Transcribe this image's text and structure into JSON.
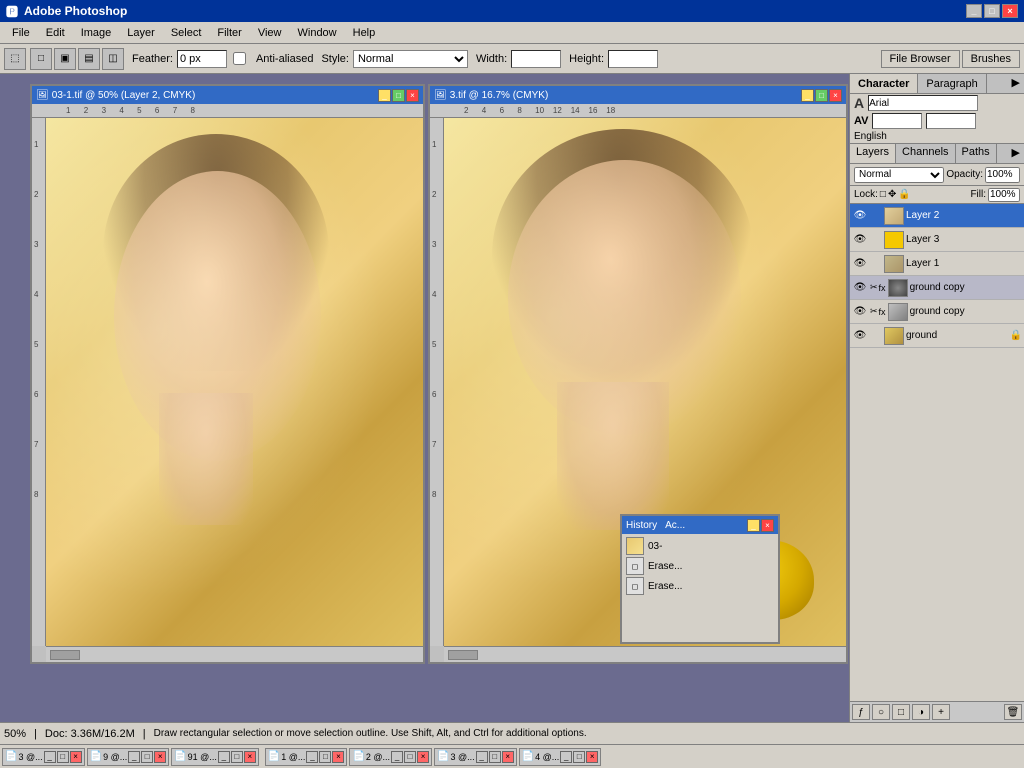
{
  "app": {
    "title": "Adobe Photoshop",
    "titlebar_controls": [
      "_",
      "□",
      "×"
    ]
  },
  "menubar": {
    "items": [
      "File",
      "Edit",
      "Image",
      "Layer",
      "Select",
      "Filter",
      "View",
      "Window",
      "Help"
    ]
  },
  "optionsbar": {
    "feather_label": "Feather:",
    "feather_value": "0 px",
    "anti_aliased_label": "Anti-aliased",
    "style_label": "Style:",
    "style_value": "Normal",
    "width_label": "Width:",
    "height_label": "Height:"
  },
  "top_right_buttons": [
    "File Browser",
    "Brushes"
  ],
  "doc1": {
    "title": "03-1.tif @ 50% (Layer 2, CMYK)",
    "zoom": "50%"
  },
  "doc2": {
    "title": "3.tif @ 16.7% (CMYK)"
  },
  "character_panel": {
    "tabs": [
      "Character",
      "Paragraph"
    ],
    "font": "Arial",
    "english_label": "English"
  },
  "layers_panel": {
    "tabs": [
      "Layers",
      "Channels",
      "Paths"
    ],
    "mode": "Normal",
    "opacity_label": "Opacity:",
    "lock_label": "Lock:",
    "fill_label": "Fill:",
    "layers": [
      {
        "name": "Layer 2",
        "active": true,
        "type": "normal",
        "eye": true
      },
      {
        "name": "Layer 3",
        "active": false,
        "type": "yellow",
        "eye": true
      },
      {
        "name": "Layer 1",
        "active": false,
        "type": "normal",
        "eye": true
      },
      {
        "name": "ground copy",
        "active": false,
        "type": "effect",
        "eye": true
      },
      {
        "name": "ground copy",
        "active": false,
        "type": "effect2",
        "eye": true
      },
      {
        "name": "ground",
        "active": false,
        "type": "base",
        "eye": true
      }
    ]
  },
  "history_panel": {
    "title": "History",
    "tabs": [
      "History",
      "Ac..."
    ],
    "items": [
      {
        "label": "03-",
        "icon": "photo"
      },
      {
        "label": "Erase...",
        "icon": "eraser"
      },
      {
        "label": "Erase...",
        "icon": "eraser"
      }
    ]
  },
  "statusbar": {
    "zoom": "50%",
    "doc_info": "Doc: 3.36M/16.2M",
    "hint": "Draw rectangular selection or move selection outline. Use Shift, Alt, and Ctrl for additional options."
  },
  "taskbar": {
    "items": [
      {
        "icon": "📄",
        "label": "3 @...",
        "id": "t1"
      },
      {
        "icon": "📄",
        "label": "9 @...",
        "id": "t2"
      },
      {
        "icon": "📄",
        "label": "91 @...",
        "id": "t3"
      },
      {
        "icon": "📄",
        "label": "1 @...",
        "id": "t4"
      },
      {
        "icon": "📄",
        "label": "2 @...",
        "id": "t5"
      },
      {
        "icon": "📄",
        "label": "3 @...",
        "id": "t6"
      },
      {
        "icon": "📄",
        "label": "4 @...",
        "id": "t7"
      }
    ]
  },
  "toolbox": {
    "tools": [
      {
        "icon": "⬚",
        "name": "marquee-tool"
      },
      {
        "icon": "✂",
        "name": "lasso-tool"
      },
      {
        "icon": "✥",
        "name": "move-tool"
      },
      {
        "icon": "◈",
        "name": "magic-wand-tool"
      },
      {
        "icon": "✂",
        "name": "crop-tool"
      },
      {
        "icon": "◉",
        "name": "healing-tool"
      },
      {
        "icon": "🖌",
        "name": "brush-tool"
      },
      {
        "icon": "S",
        "name": "clone-tool"
      },
      {
        "icon": "◼",
        "name": "eraser-tool"
      },
      {
        "icon": "░",
        "name": "gradient-tool"
      },
      {
        "icon": "◯",
        "name": "blur-tool"
      },
      {
        "icon": "△",
        "name": "dodge-tool"
      },
      {
        "icon": "✏",
        "name": "pen-tool"
      },
      {
        "icon": "T",
        "name": "text-tool"
      },
      {
        "icon": "⬡",
        "name": "shape-tool"
      },
      {
        "icon": "☞",
        "name": "notes-tool"
      },
      {
        "icon": "👁",
        "name": "eyedropper-tool"
      },
      {
        "icon": "✋",
        "name": "hand-tool"
      },
      {
        "icon": "⊕",
        "name": "zoom-tool"
      }
    ]
  },
  "colors": {
    "foreground": "#1a1a1a",
    "background": "#ffffff",
    "yellow_layer": "#f5c800",
    "accent_blue": "#316ac5"
  }
}
